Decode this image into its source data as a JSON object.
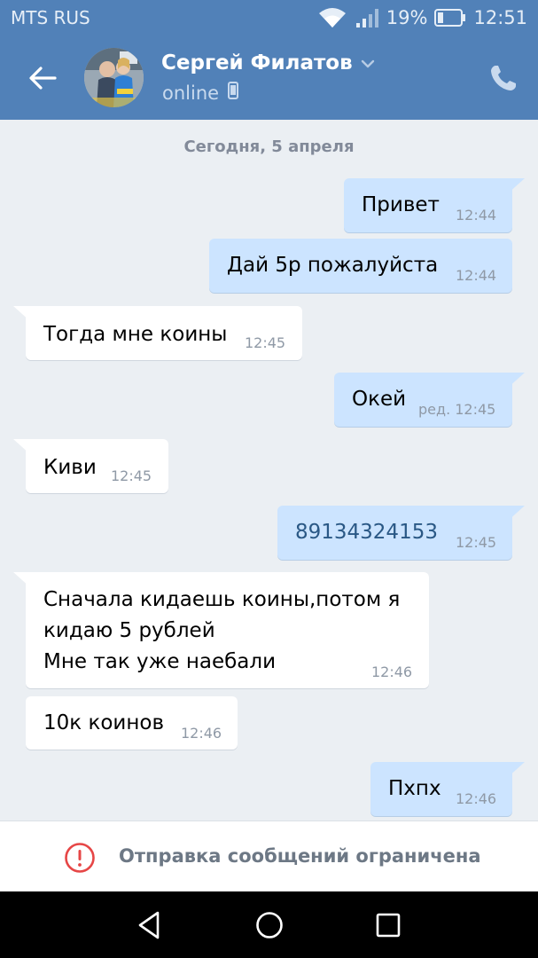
{
  "status_bar": {
    "carrier": "MTS RUS",
    "battery": "19%",
    "time": "12:51"
  },
  "header": {
    "contact_name": "Сергей Филатов",
    "presence": "online"
  },
  "chat": {
    "date_separator": "Сегодня, 5 апреля",
    "messages": [
      {
        "direction": "out",
        "text": "Привет",
        "time": "12:44"
      },
      {
        "direction": "out",
        "text": "Дай 5р пожалуйста",
        "time": "12:44"
      },
      {
        "direction": "in",
        "text": "Тогда мне коины",
        "time": "12:45"
      },
      {
        "direction": "out",
        "text": "Окей",
        "time": "ред. 12:45"
      },
      {
        "direction": "in",
        "text": "Киви",
        "time": "12:45"
      },
      {
        "direction": "out",
        "text": "89134324153",
        "time": "12:45"
      },
      {
        "direction": "in",
        "text_lines": [
          "Сначала кидаешь коины,потом я",
          "кидаю 5 рублей",
          "Мне так уже наебали"
        ],
        "time": "12:46"
      },
      {
        "direction": "in",
        "text": "10к коинов",
        "time": "12:46"
      },
      {
        "direction": "out",
        "text": "Пхпх",
        "time": "12:46"
      }
    ]
  },
  "restriction_bar": {
    "label": "Отправка сообщений ограничена"
  },
  "colors": {
    "header_bg": "#5181b8",
    "chat_bg": "#ebeff3",
    "outgoing_bubble": "#cce4ff",
    "incoming_bubble": "#ffffff",
    "phone_link": "#2a5885",
    "warning_red": "#e64646"
  },
  "icons": [
    "wifi-icon",
    "signal-icon",
    "battery-icon",
    "back-arrow-icon",
    "chevron-down-icon",
    "mobile-device-icon",
    "phone-call-icon",
    "warning-icon",
    "nav-back-icon",
    "nav-home-icon",
    "nav-recents-icon"
  ]
}
